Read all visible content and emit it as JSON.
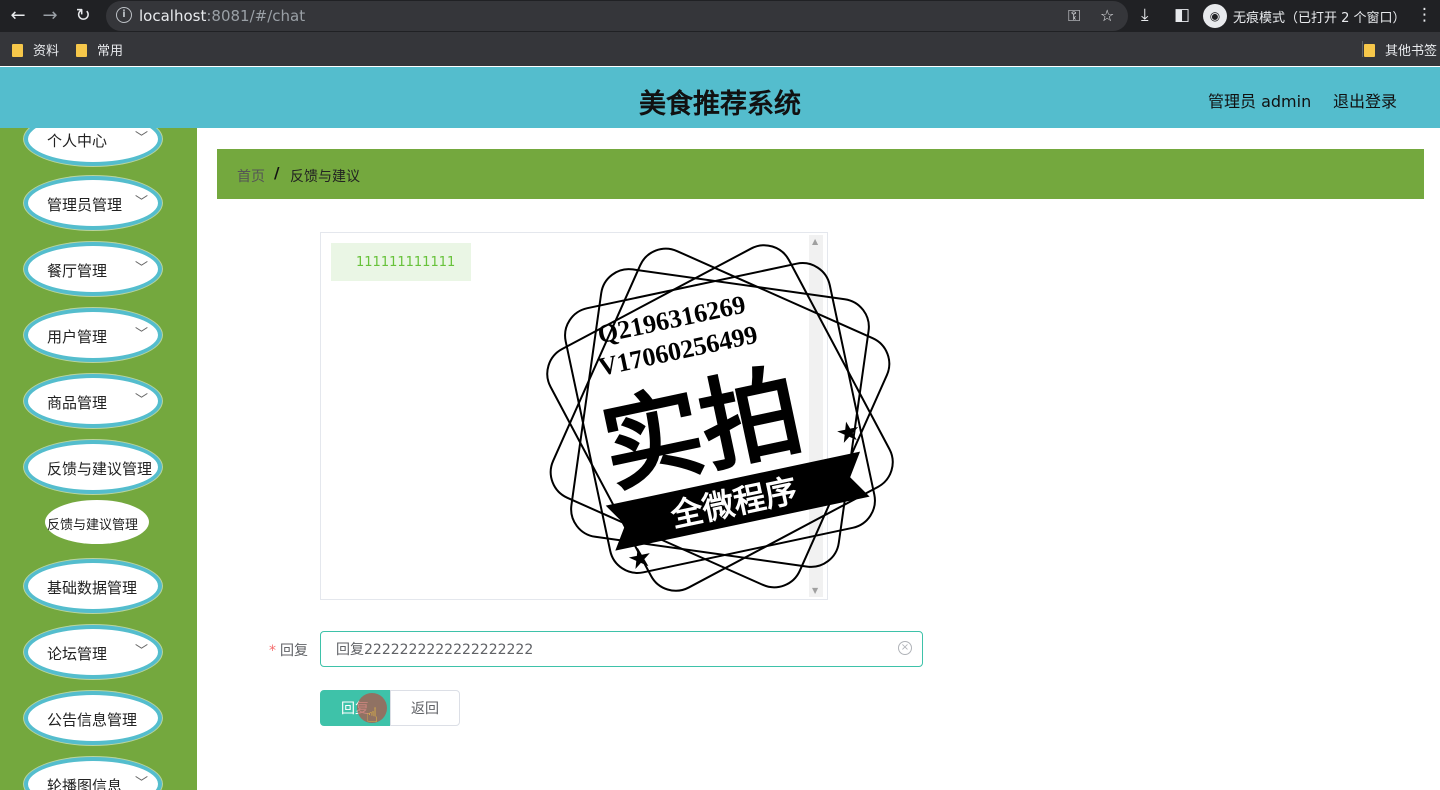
{
  "browser": {
    "url_host": "localhost",
    "url_rest": ":8081/#/chat",
    "incognito_text": "无痕模式（已打开 2 个窗口）",
    "bookmarks": [
      "资料",
      "常用"
    ],
    "other_bookmarks": "其他书签"
  },
  "header": {
    "title": "美食推荐系统",
    "user": "管理员 admin",
    "logout": "退出登录",
    "bg_color": "#54bdcd"
  },
  "sidebar": {
    "bg_color": "#74a83e",
    "items": [
      {
        "label": "个人中心"
      },
      {
        "label": "管理员管理"
      },
      {
        "label": "餐厅管理"
      },
      {
        "label": "用户管理"
      },
      {
        "label": "商品管理"
      },
      {
        "label": "反馈与建议管理"
      },
      {
        "label": "基础数据管理"
      },
      {
        "label": "论坛管理"
      },
      {
        "label": "公告信息管理"
      },
      {
        "label": "轮播图信息"
      }
    ],
    "sub_item": "反馈与建议管理"
  },
  "breadcrumb": {
    "home": "首页",
    "separator": "/",
    "current": "反馈与建议"
  },
  "chat": {
    "messages": [
      "111111111111"
    ]
  },
  "form": {
    "required_mark": "*",
    "reply_label": "回复",
    "reply_value": "回复2222222222222222222",
    "submit_label": "回复",
    "back_label": "返回",
    "accent_color": "#3ec2a9"
  },
  "watermark": {
    "line1": "Q2196316269",
    "line2": "V17060256499",
    "big": "实拍",
    "banner": "全微程序"
  }
}
